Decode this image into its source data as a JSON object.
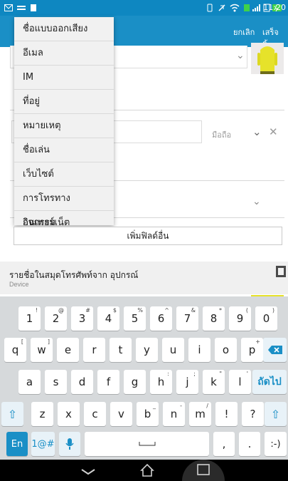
{
  "status_bar": {
    "time": "11:20",
    "icons": [
      "message-icon",
      "wifi-icon",
      "signal-icon",
      "battery-icon"
    ]
  },
  "app_bar": {
    "cancel_label": "ยกเลิก",
    "done_label": "เสร็จสิ้น"
  },
  "menu": {
    "items": [
      {
        "label": "ชื่อแบบออกเสียง"
      },
      {
        "label": "อีเมล"
      },
      {
        "label": "IM"
      },
      {
        "label": "ที่อยู่"
      },
      {
        "label": "หมายเหตุ"
      },
      {
        "label": "ชื่อเล่น"
      },
      {
        "label": "เว็บไซต์"
      },
      {
        "label": "การโทรทางอินเทอร์เน็ต"
      },
      {
        "label": "กิจกรรม"
      }
    ]
  },
  "form": {
    "phone_type_label": "มือถือ",
    "add_field_label": "เพิ่มฟิลด์อื่น"
  },
  "section": {
    "title": "รายชื่อในสมุดโทรศัพท์จาก อุปกรณ์",
    "subtitle": "Device"
  },
  "keyboard": {
    "row1": [
      {
        "k": "1",
        "s": "!"
      },
      {
        "k": "2",
        "s": "@"
      },
      {
        "k": "3",
        "s": "#"
      },
      {
        "k": "4",
        "s": "$"
      },
      {
        "k": "5",
        "s": "%"
      },
      {
        "k": "6",
        "s": "^"
      },
      {
        "k": "7",
        "s": "&"
      },
      {
        "k": "8",
        "s": "*"
      },
      {
        "k": "9",
        "s": "("
      },
      {
        "k": "0",
        "s": ")"
      }
    ],
    "row2": [
      {
        "k": "q",
        "s": "["
      },
      {
        "k": "w",
        "s": "]"
      },
      {
        "k": "e",
        "s": ""
      },
      {
        "k": "r",
        "s": ""
      },
      {
        "k": "t",
        "s": ""
      },
      {
        "k": "y",
        "s": ""
      },
      {
        "k": "u",
        "s": ""
      },
      {
        "k": "i",
        "s": ""
      },
      {
        "k": "o",
        "s": ""
      },
      {
        "k": "p",
        "s": "+"
      }
    ],
    "row3": [
      {
        "k": "a",
        "s": ""
      },
      {
        "k": "s",
        "s": ""
      },
      {
        "k": "d",
        "s": ""
      },
      {
        "k": "f",
        "s": ""
      },
      {
        "k": "g",
        "s": ""
      },
      {
        "k": "h",
        "s": ":"
      },
      {
        "k": "j",
        "s": ";"
      },
      {
        "k": "k",
        "s": "\""
      },
      {
        "k": "l",
        "s": "'"
      }
    ],
    "row4": [
      {
        "k": "z",
        "s": ""
      },
      {
        "k": "x",
        "s": ""
      },
      {
        "k": "c",
        "s": ""
      },
      {
        "k": "v",
        "s": ""
      },
      {
        "k": "b",
        "s": "_"
      },
      {
        "k": "n",
        "s": "-"
      },
      {
        "k": "m",
        "s": "/"
      },
      {
        "k": "!",
        "s": ""
      },
      {
        "k": "?",
        "s": ""
      }
    ],
    "next_label": "ถัดไป",
    "lang_label": "En",
    "symbols_label": "1@#",
    "comma_label": ",",
    "period_label": ".",
    "emoticon_label": ":-)"
  },
  "colors": {
    "accent": "#1a8fc6",
    "status_bar": "#0e87c1"
  }
}
